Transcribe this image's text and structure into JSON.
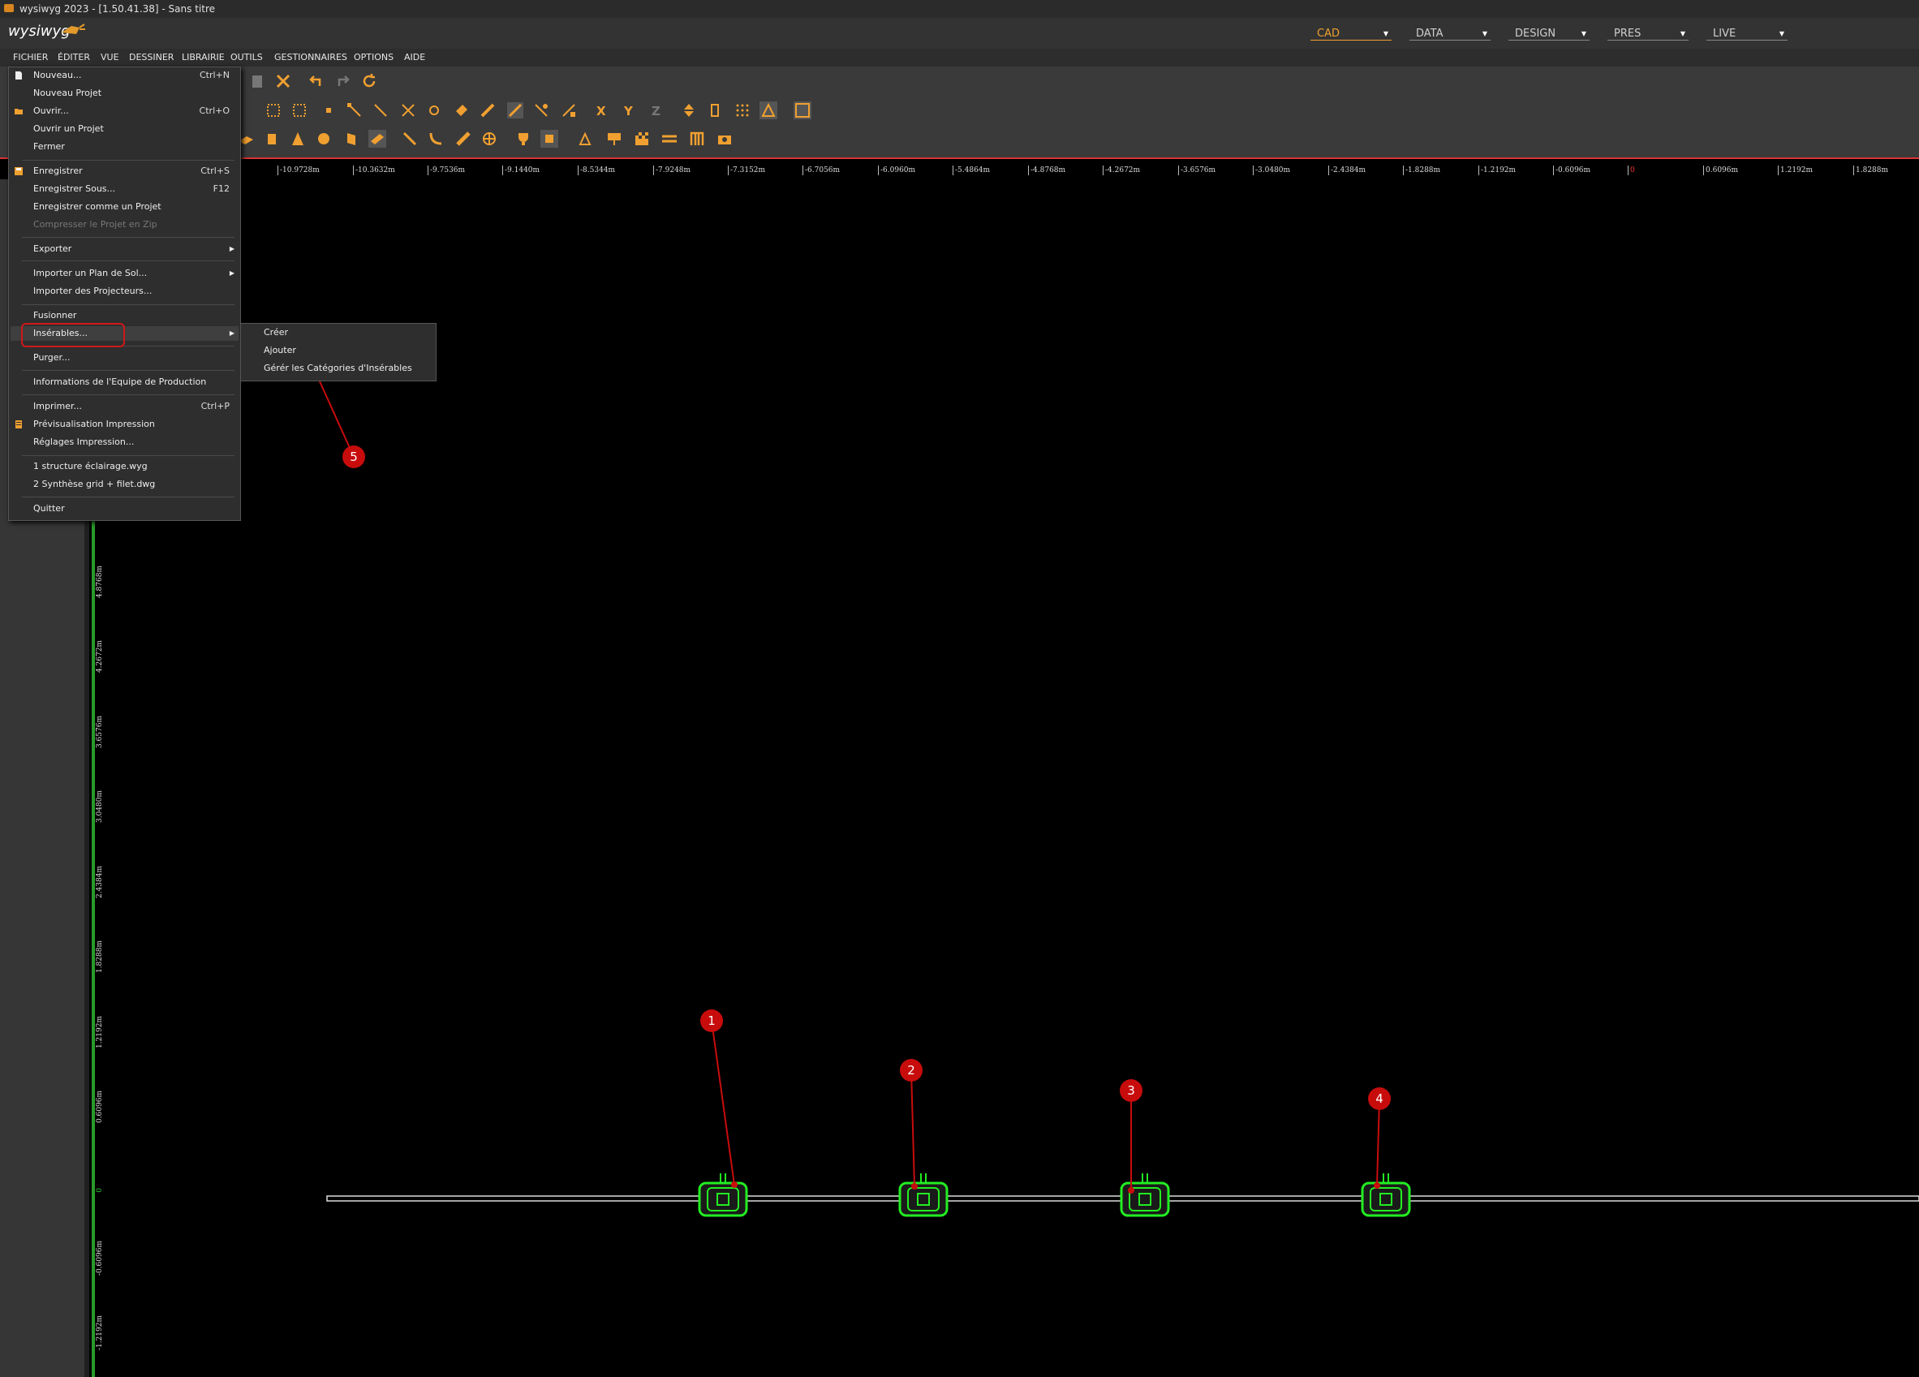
{
  "window": {
    "title": "wysiwyg 2023 - [1.50.41.38] - Sans titre"
  },
  "app": {
    "logo": "wysiwyg"
  },
  "modes": [
    {
      "label": "CAD",
      "active": true
    },
    {
      "label": "DATA",
      "active": false
    },
    {
      "label": "DESIGN",
      "active": false
    },
    {
      "label": "PRES",
      "active": false
    },
    {
      "label": "LIVE",
      "active": false
    }
  ],
  "menubar": [
    "FICHIER",
    "ÉDITER",
    "VUE",
    "DESSINER",
    "LIBRAIRIE",
    "OUTILS",
    "GESTIONNAIRES",
    "OPTIONS",
    "AIDE"
  ],
  "file_menu": {
    "items": [
      {
        "label": "Nouveau...",
        "shortcut": "Ctrl+N",
        "icon": "new-document-icon"
      },
      {
        "label": "Nouveau Projet",
        "shortcut": ""
      },
      {
        "label": "Ouvrir...",
        "shortcut": "Ctrl+O",
        "icon": "folder-open-icon"
      },
      {
        "label": "Ouvrir un Projet",
        "shortcut": ""
      },
      {
        "label": "Fermer",
        "shortcut": ""
      },
      {
        "label": "Enregistrer",
        "shortcut": "Ctrl+S",
        "icon": "save-icon"
      },
      {
        "label": "Enregistrer Sous...",
        "shortcut": "F12"
      },
      {
        "label": "Enregistrer comme un Projet",
        "shortcut": ""
      },
      {
        "label": "Compresser le Projet en Zip",
        "shortcut": "",
        "disabled": true
      },
      {
        "label": "Exporter",
        "shortcut": "",
        "submenu": true
      },
      {
        "label": "Importer un Plan de Sol...",
        "shortcut": "",
        "submenu": true
      },
      {
        "label": "Importer des Projecteurs...",
        "shortcut": ""
      },
      {
        "label": "Fusionner",
        "shortcut": ""
      },
      {
        "label": "Insérables...",
        "shortcut": "",
        "submenu": true,
        "highlighted": true
      },
      {
        "label": "Purger...",
        "shortcut": ""
      },
      {
        "label": "Informations de l'Equipe de Production",
        "shortcut": ""
      },
      {
        "label": "Imprimer...",
        "shortcut": "Ctrl+P"
      },
      {
        "label": "Prévisualisation Impression",
        "shortcut": "",
        "icon": "print-preview-icon"
      },
      {
        "label": "Réglages Impression...",
        "shortcut": ""
      },
      {
        "label": "1 structure éclairage.wyg",
        "shortcut": ""
      },
      {
        "label": "2 Synthèse grid + filet.dwg",
        "shortcut": ""
      },
      {
        "label": "Quitter",
        "shortcut": ""
      }
    ]
  },
  "submenu": {
    "items": [
      "Créer",
      "Ajouter",
      "Gérér les Catégories d'Insérables"
    ]
  },
  "ruler_top": [
    "-10.9728m",
    "-10.3632m",
    "-9.7536m",
    "-9.1440m",
    "-8.5344m",
    "-7.9248m",
    "-7.3152m",
    "-6.7056m",
    "-6.0960m",
    "-5.4864m",
    "-4.8768m",
    "-4.2672m",
    "-3.6576m",
    "-3.0480m",
    "-2.4384m",
    "-1.8288m",
    "-1.2192m",
    "-0.6096m",
    "0",
    "0.6096m",
    "1.2192m",
    "1.8288m"
  ],
  "ruler_left": [
    "4.8768m",
    "4.2672m",
    "3.6576m",
    "3.0480m",
    "2.4384m",
    "1.8288m",
    "1.2192m",
    "0.6096m",
    "0",
    "-0.6096m",
    "-1.2192m"
  ],
  "annotations": [
    "1",
    "2",
    "3",
    "4",
    "5"
  ],
  "colors": {
    "accent": "#f0a030",
    "fixture": "#22ee22",
    "annotation": "#c80c0c",
    "ruler_red": "#dd3333"
  }
}
